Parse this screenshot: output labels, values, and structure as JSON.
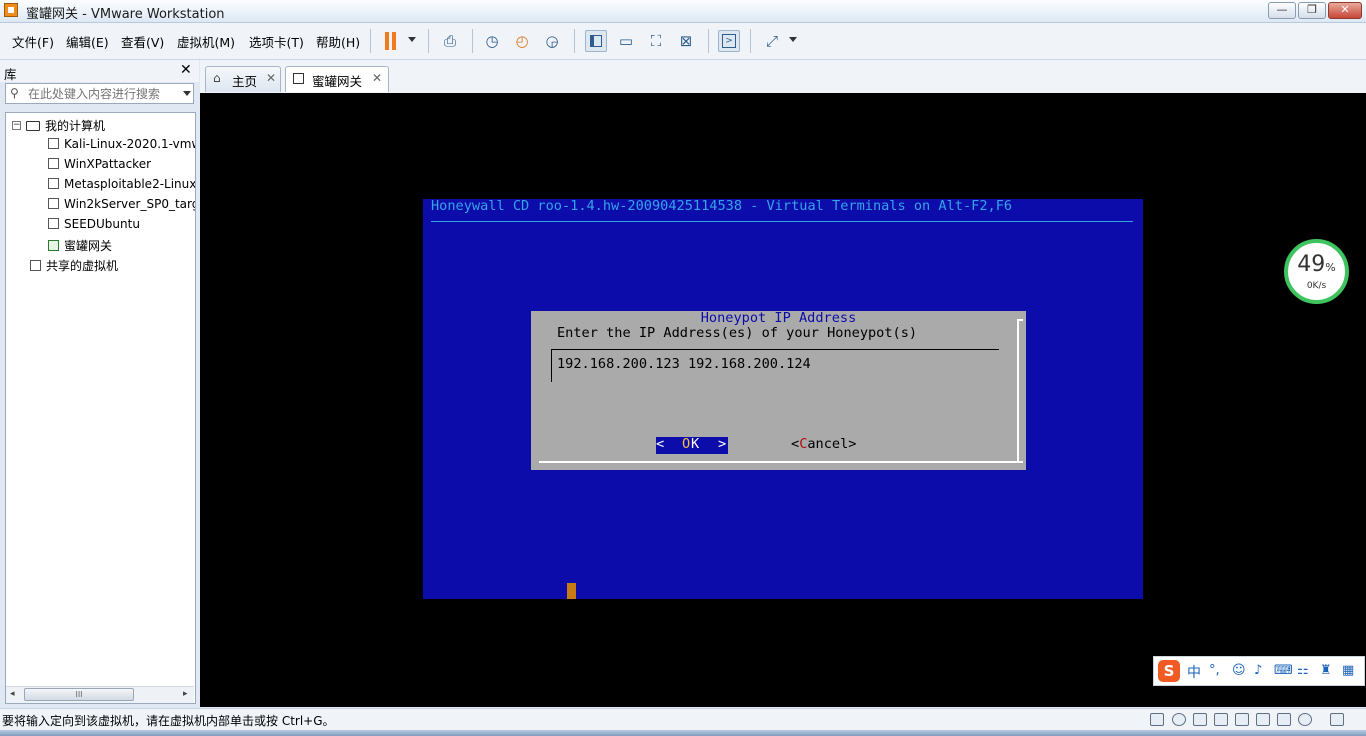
{
  "window": {
    "title": "蜜罐网关 - VMware Workstation",
    "min_glyph": "—",
    "max_glyph": "❐",
    "close_glyph": "✕"
  },
  "menu": [
    "文件(F)",
    "编辑(E)",
    "查看(V)",
    "虚拟机(M)",
    "选项卡(T)",
    "帮助(H)"
  ],
  "toolbar": {
    "icons": [
      "send-ctrl-alt-del-icon",
      "snapshot-icon",
      "revert-snapshot-icon",
      "snapshot-manager-icon",
      "show-library-icon",
      "thumbnail-bar-icon",
      "fullscreen-icon",
      "unity-icon",
      "console-view-icon",
      "stretch-icon"
    ]
  },
  "library": {
    "title": "库",
    "close_glyph": "✕",
    "search_placeholder": "在此处键入内容进行搜索",
    "root": "我的计算机",
    "vms": [
      "Kali-Linux-2020.1-vmw",
      "WinXPattacker",
      "Metasploitable2-Linux",
      "Win2kServer_SP0_targ",
      "SEEDUbuntu",
      "蜜罐网关"
    ],
    "running_vm": "蜜罐网关",
    "shared": "共享的虚拟机",
    "scroll_grip": "III"
  },
  "tabs": [
    {
      "label": "主页",
      "icon": "home-icon",
      "active": false
    },
    {
      "label": "蜜罐网关",
      "icon": "vm-running-icon",
      "active": true
    }
  ],
  "tab_close_glyph": "✕",
  "console": {
    "header": "Honeywall CD roo-1.4.hw-20090425114538 - Virtual Terminals on Alt-F2,F6",
    "dialog": {
      "title": "Honeypot IP Address",
      "prompt": "Enter the IP Address(es) of your Honeypot(s)",
      "value": "192.168.200.123 192.168.200.124",
      "ok_left": "<",
      "ok_pre": "  ",
      "ok_hot": "O",
      "ok_rest": "K",
      "ok_right": ">",
      "cancel_open": "<",
      "cancel_hot": "C",
      "cancel_rest": "ancel>"
    }
  },
  "net_gauge": {
    "percent": "49",
    "percent_sign": "%",
    "rate": "0K/s"
  },
  "ime": {
    "logo": "S",
    "mode": "中",
    "punct": "°,"
  },
  "status": {
    "text": "要将输入定向到该虚拟机，请在虚拟机内部单击或按 Ctrl+G。"
  },
  "colors": {
    "console_bg": "#0c0caa",
    "console_text": "#36a3e6",
    "dialog_bg": "#aaaaaa",
    "accent_orange": "#f07a1c",
    "gauge_green": "#3ec35e"
  }
}
